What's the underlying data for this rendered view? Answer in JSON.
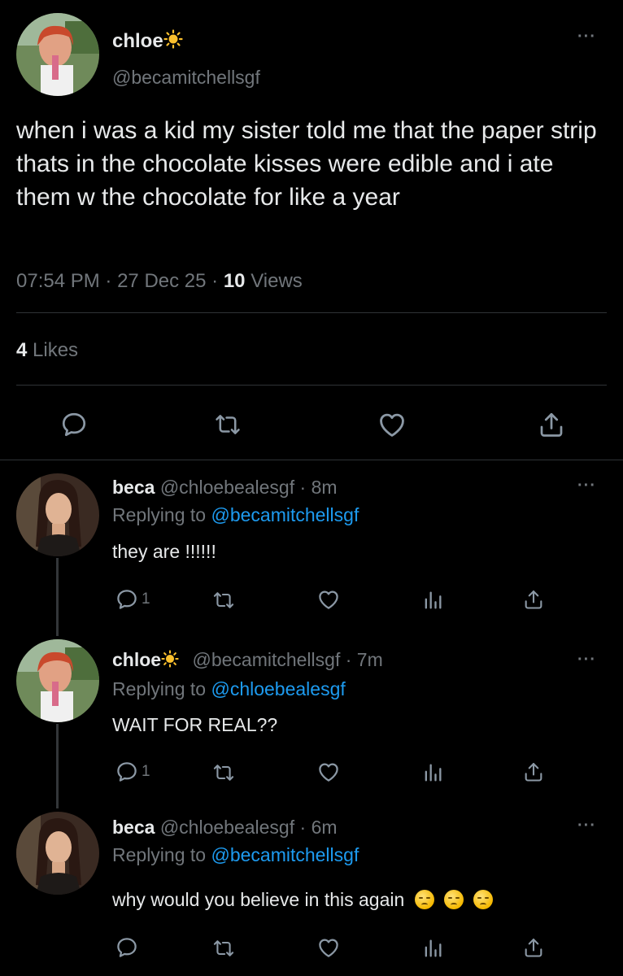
{
  "main_tweet": {
    "display_name": "chloe",
    "name_emoji": "sun-emoji",
    "handle": "@becamitchellsgf",
    "text": "when i was a kid my sister told me that the paper strip thats in the chocolate kisses were edible and i ate them w the chocolate for like a year",
    "time": "07:54 PM",
    "sep1": "·",
    "date": "27 Dec 25",
    "sep2": "·",
    "views_count": "10",
    "views_label": "Views",
    "likes_count": "4",
    "likes_label": "Likes",
    "more": "···"
  },
  "replies": [
    {
      "display_name": "beca",
      "handle": "@chloebealesgf",
      "age": "· 8m",
      "replying_label": "Replying to",
      "replying_to": "@becamitchellsgf",
      "text": "they are !!!!!!",
      "reply_count": "1",
      "more": "···"
    },
    {
      "display_name": "chloe",
      "name_emoji": "sun-emoji",
      "handle": "@becamitchellsgf",
      "age": "· 7m",
      "replying_label": "Replying to",
      "replying_to": "@chloebealesgf",
      "text": "WAIT FOR REAL??",
      "reply_count": "1",
      "more": "···"
    },
    {
      "display_name": "beca",
      "handle": "@chloebealesgf",
      "age": "· 6m",
      "replying_label": "Replying to",
      "replying_to": "@becamitchellsgf",
      "text": "why would you believe in this again",
      "text_emojis": [
        "pensive-face-emoji",
        "pensive-face-emoji",
        "pensive-face-emoji"
      ],
      "more": "···"
    }
  ],
  "colors": {
    "background": "#000000",
    "text": "#e7e9ea",
    "muted": "#71767b",
    "link": "#1d9bf0",
    "divider": "#2f3336"
  }
}
